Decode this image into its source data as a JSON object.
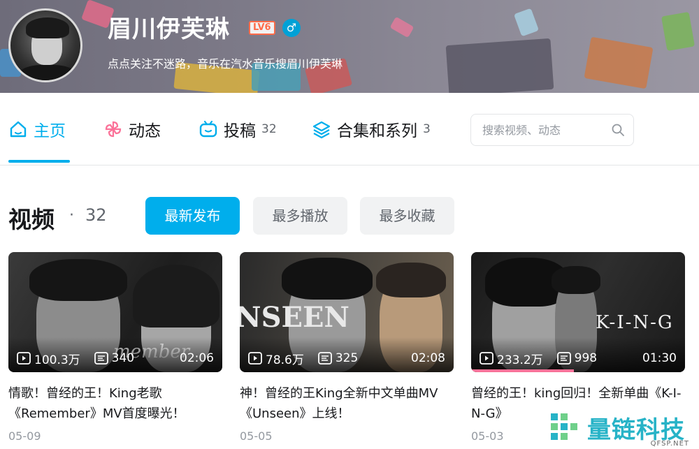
{
  "profile": {
    "username": "眉川伊芙琳",
    "level": "LV6",
    "gender_icon": "male-icon",
    "sign": "点点关注不迷路，音乐在汽水音乐搜眉川伊芙琳"
  },
  "tabs": [
    {
      "label": "主页",
      "icon": "home-icon",
      "count": ""
    },
    {
      "label": "动态",
      "icon": "pinwheel-icon",
      "count": ""
    },
    {
      "label": "投稿",
      "icon": "tv-icon",
      "count": "32"
    },
    {
      "label": "合集和系列",
      "icon": "layers-icon",
      "count": "3"
    }
  ],
  "search": {
    "placeholder": "搜索视频、动态"
  },
  "section": {
    "title": "视频",
    "dot": "·",
    "count": "32",
    "sort_options": [
      "最新发布",
      "最多播放",
      "最多收藏"
    ],
    "active_sort": "最新发布"
  },
  "videos": [
    {
      "plays": "100.3万",
      "danmaku": "340",
      "duration": "02:06",
      "title": "情歌！曾经的王！King老歌《Remember》MV首度曝光！",
      "date": "05-09",
      "thumb_text": "member",
      "watch_progress": 0
    },
    {
      "plays": "78.6万",
      "danmaku": "325",
      "duration": "02:08",
      "title": "神！曾经的王King全新中文单曲MV《Unseen》上线！",
      "date": "05-05",
      "thumb_text": "NSEEN",
      "watch_progress": 0
    },
    {
      "plays": "233.2万",
      "danmaku": "998",
      "duration": "01:30",
      "title": "曾经的王！king回归！全新单曲《K-I-N-G》",
      "date": "05-03",
      "thumb_text": "K-I-N-G",
      "watch_progress": 0.48
    }
  ],
  "watermark": {
    "name": "量链科技",
    "site": "QFSP.NET"
  },
  "colors": {
    "accent": "#00aeec",
    "level": "#ff6c4a",
    "progress": "#fb7299"
  }
}
